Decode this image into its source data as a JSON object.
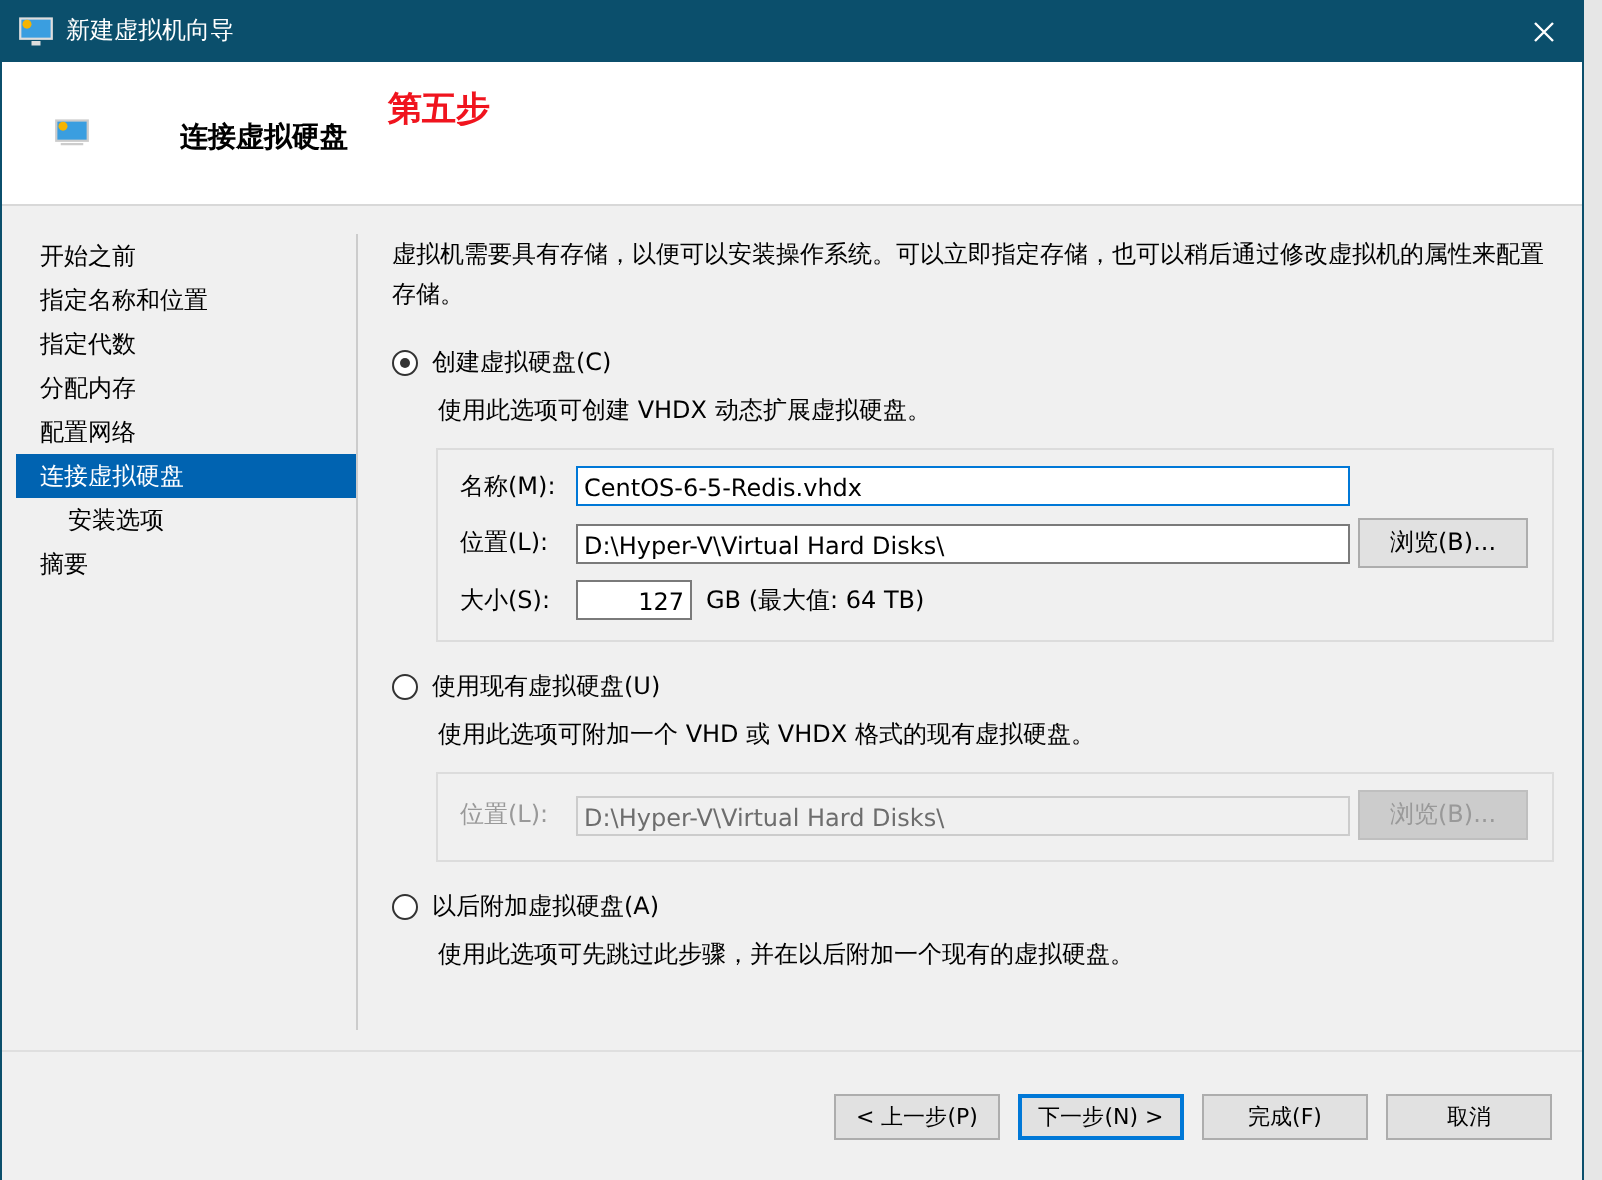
{
  "window": {
    "title": "新建虚拟机向导"
  },
  "header": {
    "title": "连接虚拟硬盘",
    "annotation": "第五步"
  },
  "sidebar": {
    "items": [
      {
        "label": "开始之前",
        "selected": false
      },
      {
        "label": "指定名称和位置",
        "selected": false
      },
      {
        "label": "指定代数",
        "selected": false
      },
      {
        "label": "分配内存",
        "selected": false
      },
      {
        "label": "配置网络",
        "selected": false
      },
      {
        "label": "连接虚拟硬盘",
        "selected": true,
        "children": [
          {
            "label": "安装选项",
            "selected": false
          }
        ]
      },
      {
        "label": "摘要",
        "selected": false
      }
    ]
  },
  "intro": "虚拟机需要具有存储，以便可以安装操作系统。可以立即指定存储，也可以稍后通过修改虚拟机的属性来配置存储。",
  "options": [
    {
      "label": "创建虚拟硬盘(C)",
      "selected": true,
      "description": "使用此选项可创建 VHDX 动态扩展虚拟硬盘。",
      "disabled": false,
      "fields": [
        {
          "kind": "text",
          "label": "名称(M):",
          "value": "CentOS-6-5-Redis.vhdx"
        },
        {
          "kind": "path",
          "label": "位置(L):",
          "value": "D:\\Hyper-V\\Virtual Hard Disks\\",
          "button": "浏览(B)..."
        },
        {
          "kind": "size",
          "label": "大小(S):",
          "value": "127",
          "unit": "GB (最大值: 64 TB)"
        }
      ]
    },
    {
      "label": "使用现有虚拟硬盘(U)",
      "selected": false,
      "description": "使用此选项可附加一个 VHD 或 VHDX 格式的现有虚拟硬盘。",
      "disabled": true,
      "fields": [
        {
          "kind": "path",
          "label": "位置(L):",
          "value": "D:\\Hyper-V\\Virtual Hard Disks\\",
          "button": "浏览(B)..."
        }
      ]
    },
    {
      "label": "以后附加虚拟硬盘(A)",
      "selected": false,
      "description": "使用此选项可先跳过此步骤，并在以后附加一个现有的虚拟硬盘。"
    }
  ],
  "buttons": [
    {
      "label": "< 上一步(P)",
      "default": false
    },
    {
      "label": "下一步(N) >",
      "default": true
    },
    {
      "label": "完成(F)",
      "default": false
    },
    {
      "label": "取消",
      "default": false
    }
  ]
}
